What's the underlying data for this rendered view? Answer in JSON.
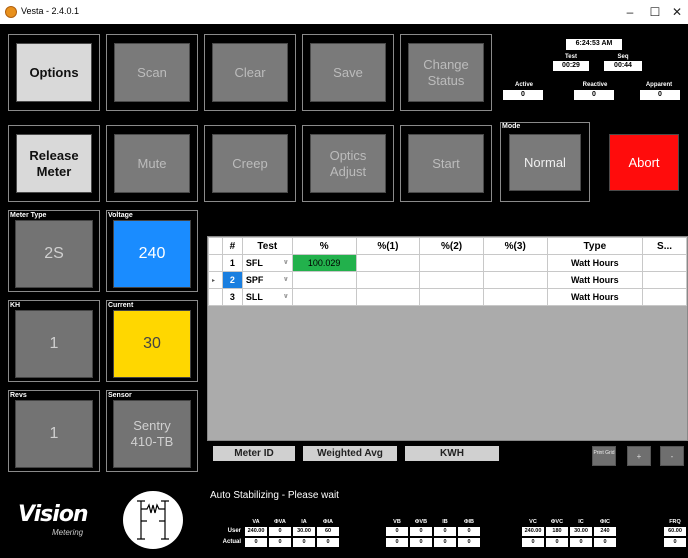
{
  "window": {
    "title": "Vesta - 2.4.0.1",
    "minimize": "–",
    "maximize": "☐",
    "close": "✕"
  },
  "buttons": {
    "options": "Options",
    "scan": "Scan",
    "clear": "Clear",
    "save": "Save",
    "change_status": "Change\nStatus",
    "release_meter": "Release\nMeter",
    "mute": "Mute",
    "creep": "Creep",
    "optics_adjust": "Optics\nAdjust",
    "start": "Start",
    "mode_label": "Mode",
    "normal": "Normal",
    "abort": "Abort"
  },
  "clock": {
    "time": "6:24:53 AM",
    "test_label": "Test",
    "test_value": "00:29",
    "seq_label": "Seq",
    "seq_value": "00:44",
    "active_label": "Active",
    "active_value": "0",
    "reactive_label": "Reactive",
    "reactive_value": "0",
    "apparent_label": "Apparent",
    "apparent_value": "0"
  },
  "panels": {
    "meter_type_label": "Meter Type",
    "meter_type": "2S",
    "voltage_label": "Voltage",
    "voltage": "240",
    "kh_label": "KH",
    "kh": "1",
    "current_label": "Current",
    "current": "30",
    "revs_label": "Revs",
    "revs": "1",
    "sensor_label": "Sensor",
    "sensor": "Sentry\n410-TB"
  },
  "grid": {
    "headers": [
      "#",
      "Test",
      "%",
      "%(1)",
      "%(2)",
      "%(3)",
      "Type",
      "S..."
    ],
    "rows": [
      {
        "num": "1",
        "test": "SFL",
        "pct": "100.029",
        "type": "Watt Hours"
      },
      {
        "num": "2",
        "test": "SPF",
        "pct": "",
        "type": "Watt Hours"
      },
      {
        "num": "3",
        "test": "SLL",
        "pct": "",
        "type": "Watt Hours"
      }
    ]
  },
  "bottom": {
    "meter_id": "Meter ID",
    "weighted_avg": "Weighted Avg",
    "kwh": "KWH",
    "print_grid": "Print Grid",
    "plus": "+",
    "minus": "-"
  },
  "status": "Auto Stabilizing - Please wait",
  "logo": {
    "word": "Vision",
    "sub": "Metering"
  },
  "phases": {
    "row_user": "User",
    "row_actual": "Actual",
    "groups": [
      {
        "headers": [
          "VA",
          "ΦVA",
          "IA",
          "ΦIA"
        ],
        "user": [
          "240.00",
          "0",
          "30.00",
          "60"
        ],
        "actual": [
          "0",
          "0",
          "0",
          "0"
        ]
      },
      {
        "headers": [
          "VB",
          "ΦVB",
          "IB",
          "ΦIB"
        ],
        "user": [
          "0",
          "0",
          "0",
          "0"
        ],
        "actual": [
          "0",
          "0",
          "0",
          "0"
        ]
      },
      {
        "headers": [
          "VC",
          "ΦVC",
          "IC",
          "ΦIC"
        ],
        "user": [
          "240.00",
          "180",
          "30.00",
          "240"
        ],
        "actual": [
          "0",
          "0",
          "0",
          "0"
        ]
      },
      {
        "headers": [
          "FRQ"
        ],
        "user": [
          "60.00"
        ],
        "actual": [
          "0"
        ]
      }
    ]
  },
  "colors": {
    "abort": "#ff0c0c",
    "voltage_tile": "#1a8cff",
    "current_tile": "#ffd700",
    "pct_cell": "#22b14c"
  }
}
